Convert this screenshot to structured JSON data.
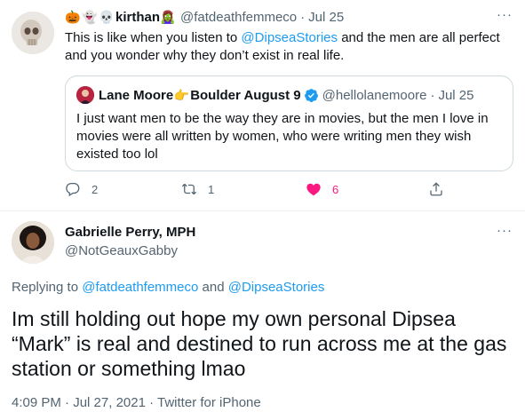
{
  "tweet": {
    "emojis": [
      "🎃",
      "👻",
      "💀"
    ],
    "display_name": "kirthan",
    "name_emoji": "🧟‍♀️",
    "handle": "@fatdeathfemmeco",
    "separator": "·",
    "date": "Jul 25",
    "more_label": "···",
    "text_before": "This is like when you listen to ",
    "mention": "@DipseaStories",
    "text_after": " and the men are all perfect and you wonder why they don’t exist in real life.",
    "quote": {
      "display_name": "Lane Moore",
      "name_emoji": "👉",
      "name_suffix": " Boulder August 9",
      "handle": "@hellolanemoore",
      "separator": "·",
      "date": "Jul 25",
      "text": "I just want men to be the way they are in movies, but the men I love in movies were all written by women, who were writing men they wish existed too lol"
    },
    "actions": {
      "reply_count": "2",
      "retweet_count": "1",
      "like_count": "6"
    }
  },
  "reply": {
    "display_name": "Gabrielle Perry, MPH",
    "handle": "@NotGeauxGabby",
    "more_label": "···",
    "replying_prefix": "Replying to ",
    "replying_user1": "@fatdeathfemmeco",
    "replying_and": " and ",
    "replying_user2": "@DipseaStories",
    "text": "Im still holding out hope my own personal Dipsea “Mark” is real and destined to run across me at the gas station or something lmao",
    "time": "4:09 PM",
    "separator": " · ",
    "date": "Jul 27, 2021",
    "source": "Twitter for iPhone"
  },
  "colors": {
    "link": "#1d9bf0",
    "secondary_text": "#536471",
    "like": "#f91880",
    "border": "#cfd9de"
  }
}
